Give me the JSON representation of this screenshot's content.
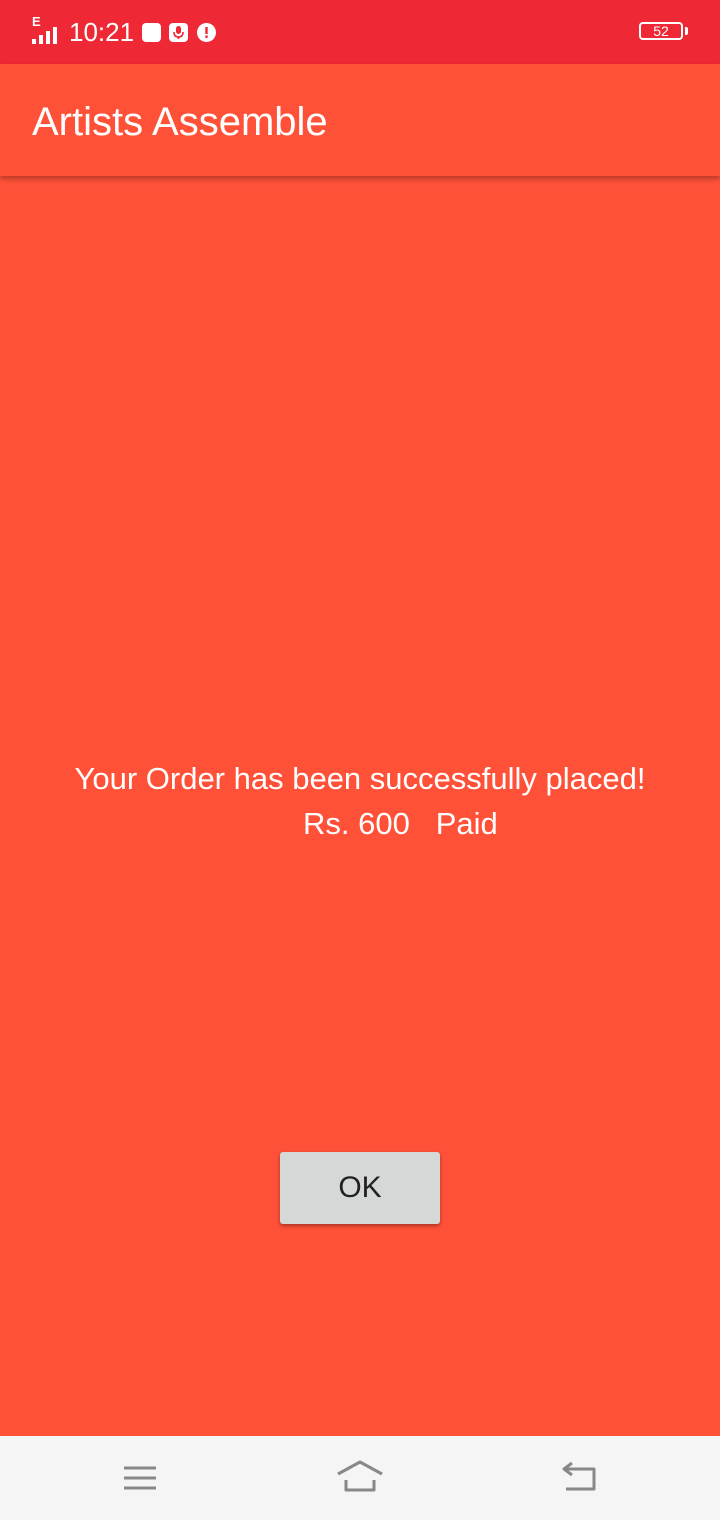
{
  "status_bar": {
    "network_type": "E",
    "time": "10:21",
    "battery_level": "52",
    "icons": [
      "signal-icon",
      "notification-square-icon",
      "mic-notification-icon",
      "alert-icon",
      "battery-icon"
    ]
  },
  "app_bar": {
    "title": "Artists Assemble"
  },
  "main": {
    "message": "Your Order has been successfully placed!",
    "amount": "Rs. 600",
    "status": "Paid",
    "ok_label": "OK"
  },
  "nav_bar": {
    "icons": [
      "menu-icon",
      "home-icon",
      "back-icon"
    ]
  },
  "colors": {
    "status_bar": "#EF2835",
    "background": "#FF5138",
    "button": "#D6D7D7",
    "nav_bar": "#F5F5F5"
  }
}
